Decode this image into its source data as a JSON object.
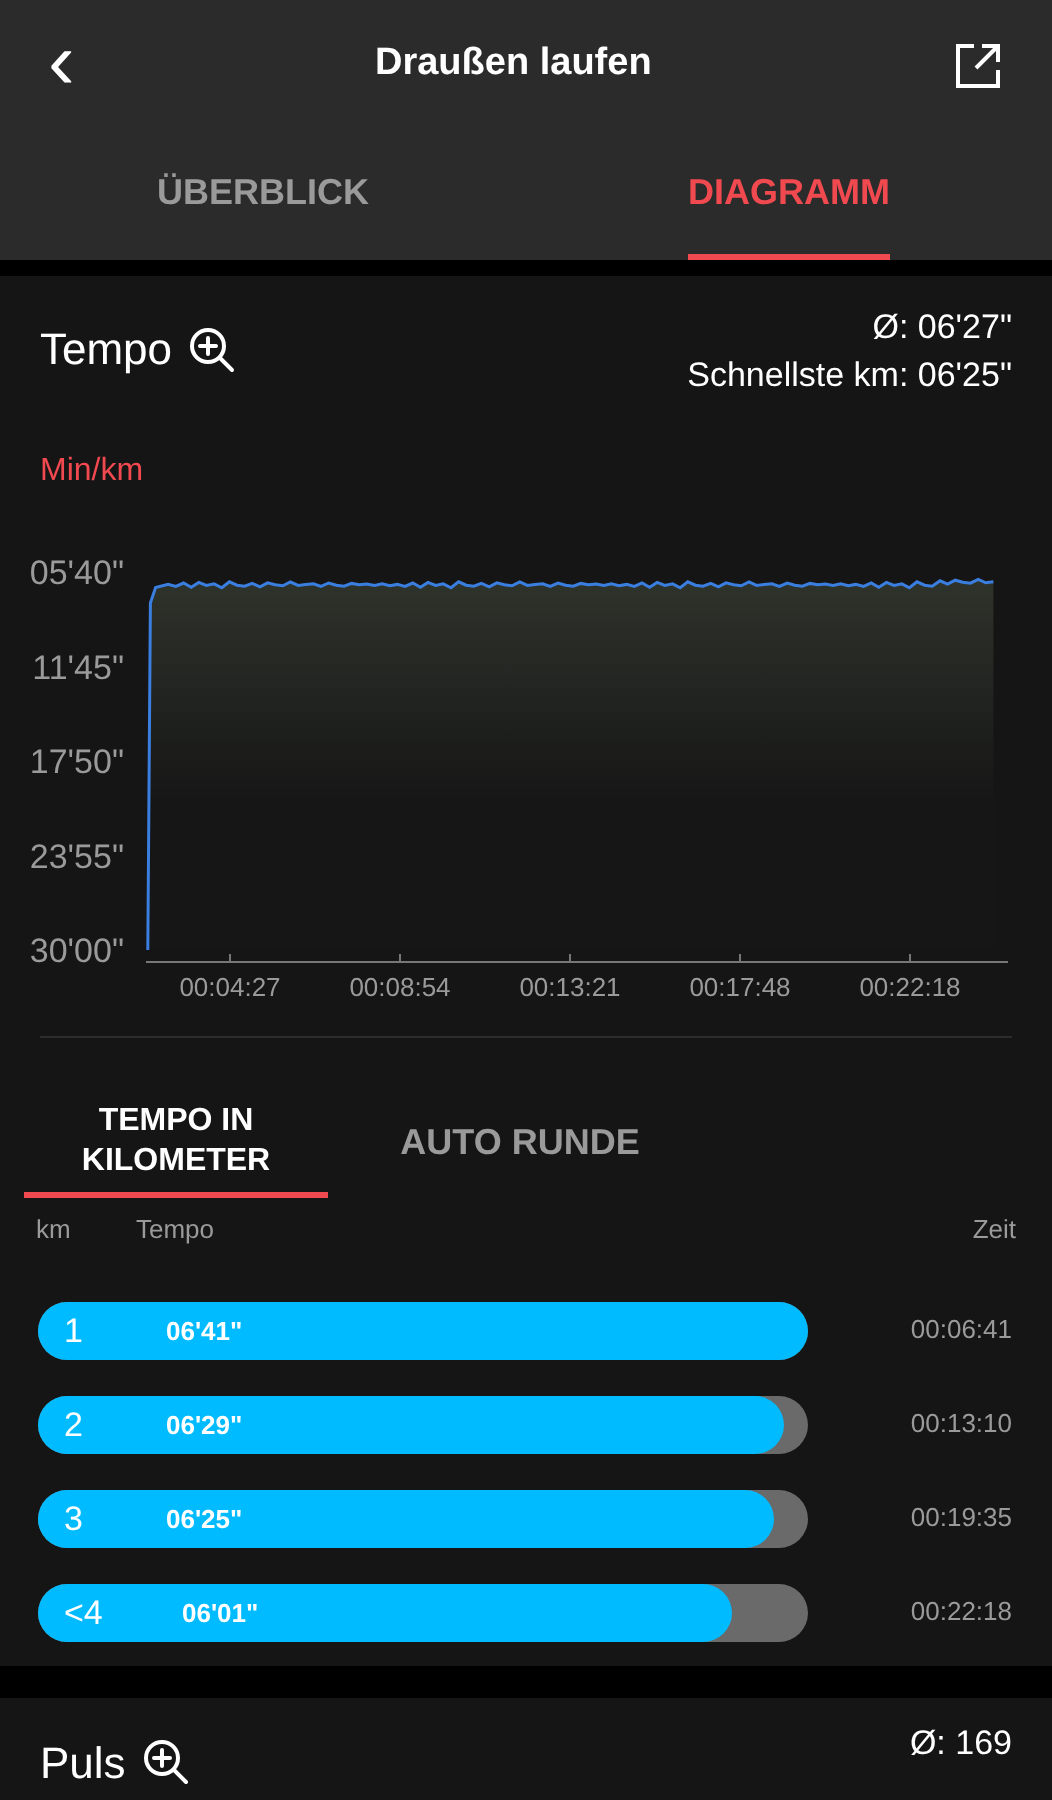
{
  "header": {
    "back": "‹",
    "title": "Draußen laufen"
  },
  "tabs": [
    {
      "label": "ÜBERBLICK",
      "selected": false
    },
    {
      "label": "DIAGRAMM",
      "selected": true
    }
  ],
  "tempo": {
    "title": "Tempo",
    "average": "Ø: 06'27\"",
    "fastest": "Schnellste km: 06'25\"",
    "unit": "Min/km",
    "y_axis_labels": [
      "05'40\"",
      "11'45\"",
      "17'50\"",
      "23'55\"",
      "30'00\""
    ],
    "x_axis_labels": [
      "00:04:27",
      "00:08:54",
      "00:13:21",
      "00:17:48",
      "00:22:18"
    ]
  },
  "lap_tabs": [
    {
      "label": "TEMPO IN KILOMETER",
      "selected": true
    },
    {
      "label": "AUTO RUNDE",
      "selected": false
    }
  ],
  "lap_columns": [
    "km",
    "Tempo",
    "Zeit"
  ],
  "laps": [
    {
      "km": "1",
      "pace": "06'41\"",
      "time": "00:06:41",
      "level": 1.0
    },
    {
      "km": "2",
      "pace": "06'29\"",
      "time": "00:13:10",
      "level": 0.97
    },
    {
      "km": "3",
      "pace": "06'25\"",
      "time": "00:19:35",
      "level": 0.955
    },
    {
      "km": "<4",
      "pace": "06'01\"",
      "time": "00:22:18",
      "level": 0.9
    }
  ],
  "puls": {
    "title": "Puls",
    "average": "Ø: 169"
  }
}
